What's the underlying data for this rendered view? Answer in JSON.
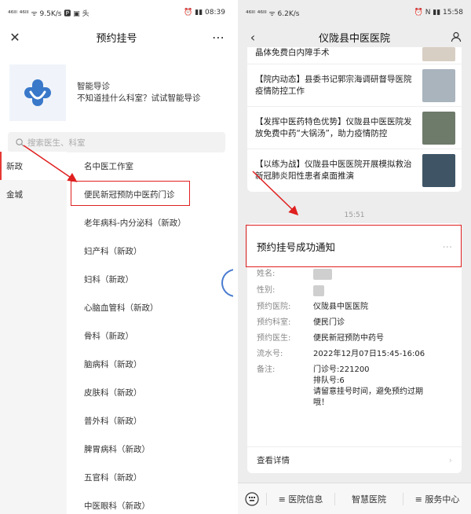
{
  "left": {
    "status": {
      "left": "⁴⁶ᴵˡˡ ⁴⁶ᴵˡˡ ᯤ 9.5K/s 🅿 ▣ 头",
      "right": "⏰ ▮▮ 08:39"
    },
    "nav": {
      "title": "预约挂号",
      "close_icon": "close-icon",
      "more_icon": "more-dots-icon"
    },
    "smart_guide": {
      "title": "智能导诊",
      "desc": "不知道挂什么科室？试试智能导诊"
    },
    "search": {
      "placeholder": "搜索医生、科室"
    },
    "areas": [
      "新政",
      "金城"
    ],
    "departments": [
      "名中医工作室",
      "便民新冠预防中医药门诊",
      "老年病科-内分泌科（新政）",
      "妇产科（新政）",
      "妇科（新政）",
      "心脑血管科（新政）",
      "骨科（新政）",
      "脑病科（新政）",
      "皮肤科（新政）",
      "普外科（新政）",
      "脾胃病科（新政）",
      "五官科（新政）",
      "中医眼科（新政）"
    ]
  },
  "right": {
    "status": {
      "left": "⁴⁶ᴵˡˡ ⁴⁶ᴵˡˡ ᯤ 6.2K/s",
      "right": "⏰ N ▮▮ 15:58"
    },
    "nav": {
      "title": "仪陇县中医医院"
    },
    "news": [
      {
        "title": "晶体免费白内障手术"
      },
      {
        "title": "【院内动态】县委书记郭宗海调研督导医院疫情防控工作"
      },
      {
        "title": "【发挥中医药特色优势】仪陇县中医医院发放免费中药“大锅汤”，助力疫情防控"
      },
      {
        "title": "【以练为战】仪陇县中医医院开展模拟救治新冠肺炎阳性患者桌面推演"
      }
    ],
    "time": "15:51",
    "notice": {
      "title": "预约挂号成功通知",
      "rows": [
        {
          "k": "姓名:",
          "v": ""
        },
        {
          "k": "性别:",
          "v": ""
        },
        {
          "k": "预约医院:",
          "v": "仪陇县中医医院"
        },
        {
          "k": "预约科室:",
          "v": "便民门诊"
        },
        {
          "k": "预约医生:",
          "v": "便民新冠预防中药号"
        },
        {
          "k": "流水号:",
          "v": "2022年12月07日15:45-16:06"
        }
      ],
      "remark_label": "备注:",
      "remark_lines": [
        "门诊号:221200",
        "排队号:6",
        "请留意挂号时间，避免预约过期",
        "哦！"
      ],
      "more": "查看详情"
    },
    "bottom_menu": [
      "≡ 医院信息",
      "智慧医院",
      "≡ 服务中心"
    ]
  },
  "colors": {
    "highlight": "#e02020",
    "accent": "#4a7bd0"
  }
}
